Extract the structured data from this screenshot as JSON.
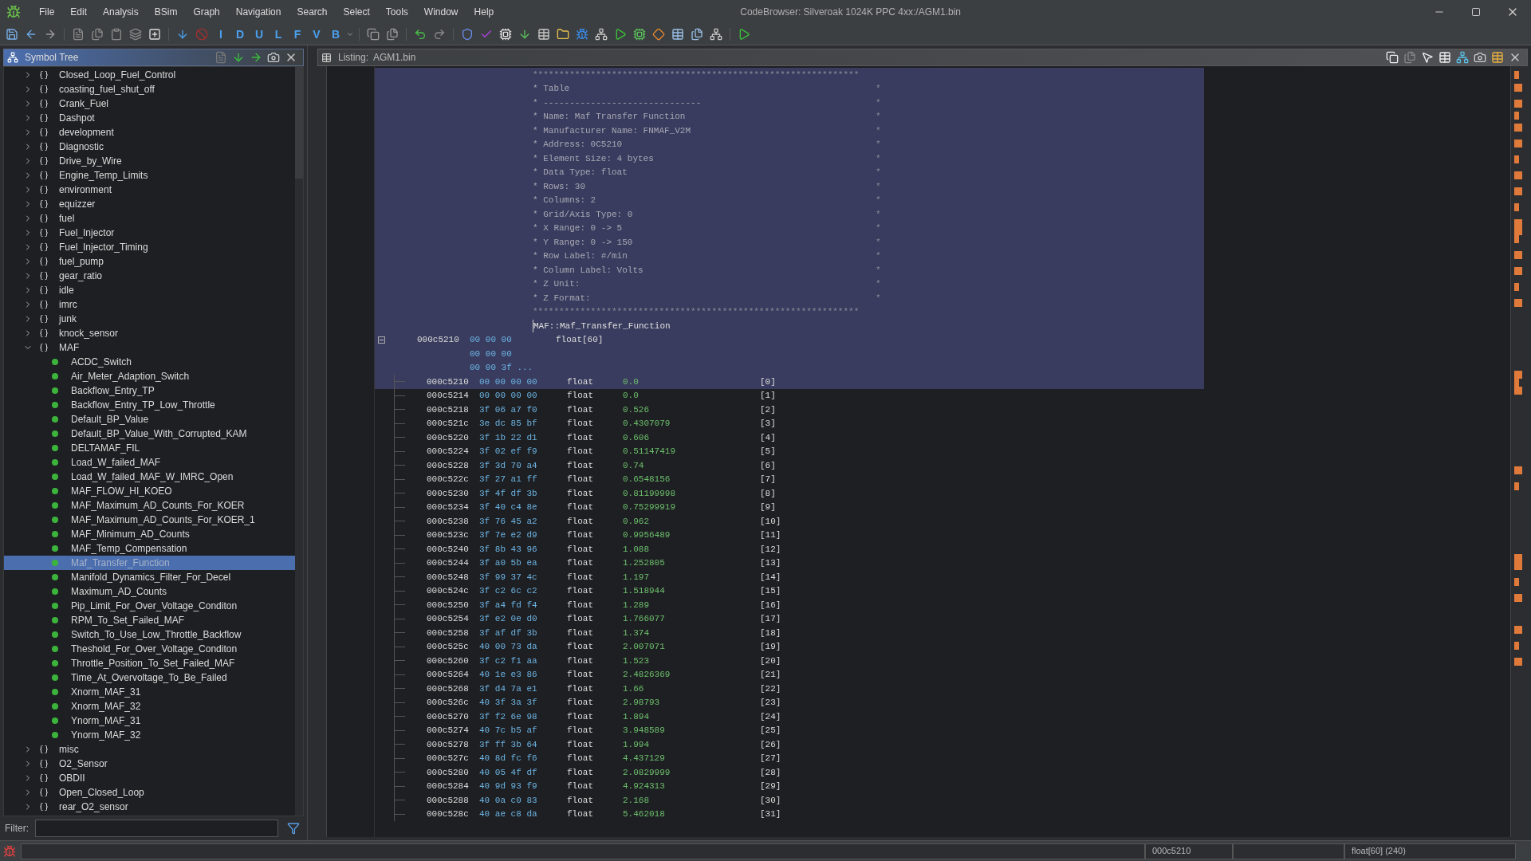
{
  "window": {
    "title": "CodeBrowser: Silveroak 1024K PPC 4xx:/AGM1.bin"
  },
  "menu": [
    "File",
    "Edit",
    "Analysis",
    "BSim",
    "Graph",
    "Navigation",
    "Search",
    "Select",
    "Tools",
    "Window",
    "Help"
  ],
  "toolbar": {
    "letter_buttons": [
      "I",
      "D",
      "U",
      "L",
      "F",
      "V",
      "B"
    ]
  },
  "symbol_tree": {
    "title": "Symbol Tree",
    "items": [
      {
        "name": "Closed_Loop_Fuel_Control",
        "expanded": false,
        "selected": false
      },
      {
        "name": "coasting_fuel_shut_off",
        "expanded": false,
        "selected": false
      },
      {
        "name": "Crank_Fuel",
        "expanded": false,
        "selected": false
      },
      {
        "name": "Dashpot",
        "expanded": false,
        "selected": false
      },
      {
        "name": "development",
        "expanded": false,
        "selected": false
      },
      {
        "name": "Diagnostic",
        "expanded": false,
        "selected": false
      },
      {
        "name": "Drive_by_Wire",
        "expanded": false,
        "selected": false
      },
      {
        "name": "Engine_Temp_Limits",
        "expanded": false,
        "selected": false
      },
      {
        "name": "environment",
        "expanded": false,
        "selected": false
      },
      {
        "name": "equizzer",
        "expanded": false,
        "selected": false
      },
      {
        "name": "fuel",
        "expanded": false,
        "selected": false
      },
      {
        "name": "Fuel_Injector",
        "expanded": false,
        "selected": false
      },
      {
        "name": "Fuel_Injector_Timing",
        "expanded": false,
        "selected": false
      },
      {
        "name": "fuel_pump",
        "expanded": false,
        "selected": false
      },
      {
        "name": "gear_ratio",
        "expanded": false,
        "selected": false
      },
      {
        "name": "idle",
        "expanded": false,
        "selected": false
      },
      {
        "name": "imrc",
        "expanded": false,
        "selected": false
      },
      {
        "name": "junk",
        "expanded": false,
        "selected": false
      },
      {
        "name": "knock_sensor",
        "expanded": false,
        "selected": false
      },
      {
        "name": "MAF",
        "expanded": true,
        "selected": false,
        "children": [
          {
            "name": "ACDC_Switch",
            "selected": false
          },
          {
            "name": "Air_Meter_Adaption_Switch",
            "selected": false
          },
          {
            "name": "Backflow_Entry_TP",
            "selected": false
          },
          {
            "name": "Backflow_Entry_TP_Low_Throttle",
            "selected": false
          },
          {
            "name": "Default_BP_Value",
            "selected": false
          },
          {
            "name": "Default_BP_Value_With_Corrupted_KAM",
            "selected": false
          },
          {
            "name": "DELTAMAF_FIL",
            "selected": false
          },
          {
            "name": "Load_W_failed_MAF",
            "selected": false
          },
          {
            "name": "Load_W_failed_MAF_W_IMRC_Open",
            "selected": false
          },
          {
            "name": "MAF_FLOW_HI_KOEO",
            "selected": false
          },
          {
            "name": "MAF_Maximum_AD_Counts_For_KOER",
            "selected": false
          },
          {
            "name": "MAF_Maximum_AD_Counts_For_KOER_1",
            "selected": false
          },
          {
            "name": "MAF_Minimum_AD_Counts",
            "selected": false
          },
          {
            "name": "MAF_Temp_Compensation",
            "selected": false
          },
          {
            "name": "Maf_Transfer_Function",
            "selected": true
          },
          {
            "name": "Manifold_Dynamics_Filter_For_Decel",
            "selected": false
          },
          {
            "name": "Maximum_AD_Counts",
            "selected": false
          },
          {
            "name": "Pip_Limit_For_Over_Voltage_Conditon",
            "selected": false
          },
          {
            "name": "RPM_To_Set_Failed_MAF",
            "selected": false
          },
          {
            "name": "Switch_To_Use_Low_Throttle_Backflow",
            "selected": false
          },
          {
            "name": "Theshold_For_Over_Voltage_Conditon",
            "selected": false
          },
          {
            "name": "Throttle_Position_To_Set_Failed_MAF",
            "selected": false
          },
          {
            "name": "Time_At_Overvoltage_To_Be_Failed",
            "selected": false
          },
          {
            "name": "Xnorm_MAF_31",
            "selected": false
          },
          {
            "name": "Xnorm_MAF_32",
            "selected": false
          },
          {
            "name": "Ynorm_MAF_31",
            "selected": false
          },
          {
            "name": "Ynorm_MAF_32",
            "selected": false
          }
        ]
      },
      {
        "name": "misc",
        "expanded": false,
        "selected": false
      },
      {
        "name": "O2_Sensor",
        "expanded": false,
        "selected": false
      },
      {
        "name": "OBDII",
        "expanded": false,
        "selected": false
      },
      {
        "name": "Open_Closed_Loop",
        "expanded": false,
        "selected": false
      },
      {
        "name": "rear_O2_sensor",
        "expanded": false,
        "selected": false
      }
    ],
    "filter_label": "Filter:"
  },
  "listing": {
    "title": "Listing:  AGM1.bin",
    "block_selected": true,
    "comment_border": "**************************************************************",
    "comment_lines": [
      {
        "text": "* Table",
        "end": "*"
      },
      {
        "text": "* ------------------------------",
        "end": "*"
      },
      {
        "text": "* Name: Maf Transfer Function",
        "end": "*"
      },
      {
        "text": "* Manufacturer Name: FNMAF_V2M",
        "end": "*"
      },
      {
        "text": "* Address: 0C5210",
        "end": "*"
      },
      {
        "text": "* Element Size: 4 bytes",
        "end": "*"
      },
      {
        "text": "* Data Type: float",
        "end": "*"
      },
      {
        "text": "* Rows: 30",
        "end": "*"
      },
      {
        "text": "* Columns: 2",
        "end": "*"
      },
      {
        "text": "* Grid/Axis Type: 0",
        "end": "*"
      },
      {
        "text": "* X Range: 0 -> 5",
        "end": "*"
      },
      {
        "text": "* Y Range: 0 -> 150",
        "end": "*"
      },
      {
        "text": "* Row Label: #/min",
        "end": "*"
      },
      {
        "text": "* Column Label: Volts",
        "end": "*"
      },
      {
        "text": "* Z Unit:",
        "end": "*"
      },
      {
        "text": "* Z Format:",
        "end": "*"
      }
    ],
    "label": "MAF::Maf_Transfer_Function",
    "data": {
      "address": "000c5210",
      "bytes": [
        "00 00 00",
        "00 00 00",
        "00 00 3f ..."
      ],
      "type": "float[60]",
      "expanded": true
    },
    "rows": [
      {
        "address": "000c5210",
        "bytes": "00 00 00 00",
        "type": "float",
        "value": "0.0",
        "index": "[0]",
        "selected": true
      },
      {
        "address": "000c5214",
        "bytes": "00 00 00 00",
        "type": "float",
        "value": "0.0",
        "index": "[1]",
        "selected": false
      },
      {
        "address": "000c5218",
        "bytes": "3f 06 a7 f0",
        "type": "float",
        "value": "0.526",
        "index": "[2]",
        "selected": false
      },
      {
        "address": "000c521c",
        "bytes": "3e dc 85 bf",
        "type": "float",
        "value": "0.4307079",
        "index": "[3]",
        "selected": false
      },
      {
        "address": "000c5220",
        "bytes": "3f 1b 22 d1",
        "type": "float",
        "value": "0.606",
        "index": "[4]",
        "selected": false
      },
      {
        "address": "000c5224",
        "bytes": "3f 02 ef f9",
        "type": "float",
        "value": "0.51147419",
        "index": "[5]",
        "selected": false
      },
      {
        "address": "000c5228",
        "bytes": "3f 3d 70 a4",
        "type": "float",
        "value": "0.74",
        "index": "[6]",
        "selected": false
      },
      {
        "address": "000c522c",
        "bytes": "3f 27 a1 ff",
        "type": "float",
        "value": "0.6548156",
        "index": "[7]",
        "selected": false
      },
      {
        "address": "000c5230",
        "bytes": "3f 4f df 3b",
        "type": "float",
        "value": "0.81199998",
        "index": "[8]",
        "selected": false
      },
      {
        "address": "000c5234",
        "bytes": "3f 40 c4 8e",
        "type": "float",
        "value": "0.75299919",
        "index": "[9]",
        "selected": false
      },
      {
        "address": "000c5238",
        "bytes": "3f 76 45 a2",
        "type": "float",
        "value": "0.962",
        "index": "[10]",
        "selected": false
      },
      {
        "address": "000c523c",
        "bytes": "3f 7e e2 d9",
        "type": "float",
        "value": "0.9956489",
        "index": "[11]",
        "selected": false
      },
      {
        "address": "000c5240",
        "bytes": "3f 8b 43 96",
        "type": "float",
        "value": "1.088",
        "index": "[12]",
        "selected": false
      },
      {
        "address": "000c5244",
        "bytes": "3f a0 5b ea",
        "type": "float",
        "value": "1.252805",
        "index": "[13]",
        "selected": false
      },
      {
        "address": "000c5248",
        "bytes": "3f 99 37 4c",
        "type": "float",
        "value": "1.197",
        "index": "[14]",
        "selected": false
      },
      {
        "address": "000c524c",
        "bytes": "3f c2 6c c2",
        "type": "float",
        "value": "1.518944",
        "index": "[15]",
        "selected": false
      },
      {
        "address": "000c5250",
        "bytes": "3f a4 fd f4",
        "type": "float",
        "value": "1.289",
        "index": "[16]",
        "selected": false
      },
      {
        "address": "000c5254",
        "bytes": "3f e2 0e d0",
        "type": "float",
        "value": "1.766077",
        "index": "[17]",
        "selected": false
      },
      {
        "address": "000c5258",
        "bytes": "3f af df 3b",
        "type": "float",
        "value": "1.374",
        "index": "[18]",
        "selected": false
      },
      {
        "address": "000c525c",
        "bytes": "40 00 73 da",
        "type": "float",
        "value": "2.007071",
        "index": "[19]",
        "selected": false
      },
      {
        "address": "000c5260",
        "bytes": "3f c2 f1 aa",
        "type": "float",
        "value": "1.523",
        "index": "[20]",
        "selected": false
      },
      {
        "address": "000c5264",
        "bytes": "40 1e e3 86",
        "type": "float",
        "value": "2.4826369",
        "index": "[21]",
        "selected": false
      },
      {
        "address": "000c5268",
        "bytes": "3f d4 7a e1",
        "type": "float",
        "value": "1.66",
        "index": "[22]",
        "selected": false
      },
      {
        "address": "000c526c",
        "bytes": "40 3f 3a 3f",
        "type": "float",
        "value": "2.98793",
        "index": "[23]",
        "selected": false
      },
      {
        "address": "000c5270",
        "bytes": "3f f2 6e 98",
        "type": "float",
        "value": "1.894",
        "index": "[24]",
        "selected": false
      },
      {
        "address": "000c5274",
        "bytes": "40 7c b5 af",
        "type": "float",
        "value": "3.948589",
        "index": "[25]",
        "selected": false
      },
      {
        "address": "000c5278",
        "bytes": "3f ff 3b 64",
        "type": "float",
        "value": "1.994",
        "index": "[26]",
        "selected": false
      },
      {
        "address": "000c527c",
        "bytes": "40 8d fc f6",
        "type": "float",
        "value": "4.437129",
        "index": "[27]",
        "selected": false
      },
      {
        "address": "000c5280",
        "bytes": "40 05 4f df",
        "type": "float",
        "value": "2.0829999",
        "index": "[28]",
        "selected": false
      },
      {
        "address": "000c5284",
        "bytes": "40 9d 93 f9",
        "type": "float",
        "value": "4.924313",
        "index": "[29]",
        "selected": false
      },
      {
        "address": "000c5288",
        "bytes": "40 0a c0 83",
        "type": "float",
        "value": "2.168",
        "index": "[30]",
        "selected": false
      },
      {
        "address": "000c528c",
        "bytes": "40 ae c8 da",
        "type": "float",
        "value": "5.462018",
        "index": "[31]",
        "selected": false
      }
    ]
  },
  "status_bar": {
    "address": "000c5210",
    "data_type": "float[60] (240)"
  }
}
